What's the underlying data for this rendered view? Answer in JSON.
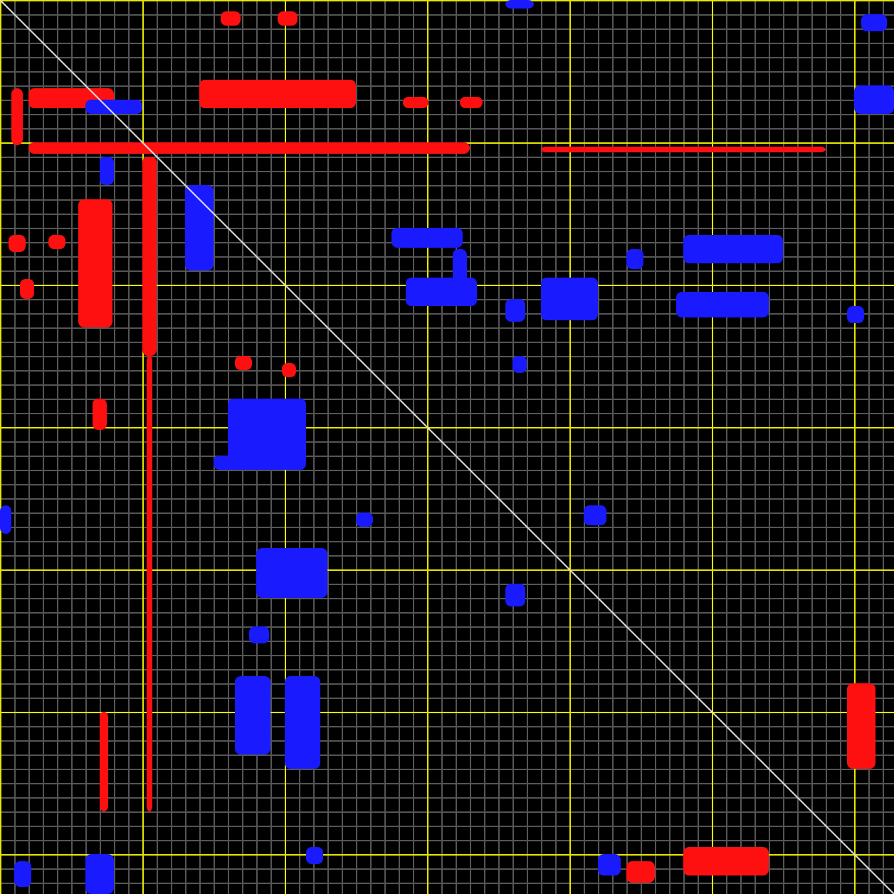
{
  "contact_map": {
    "diagonal": true
  }
}
